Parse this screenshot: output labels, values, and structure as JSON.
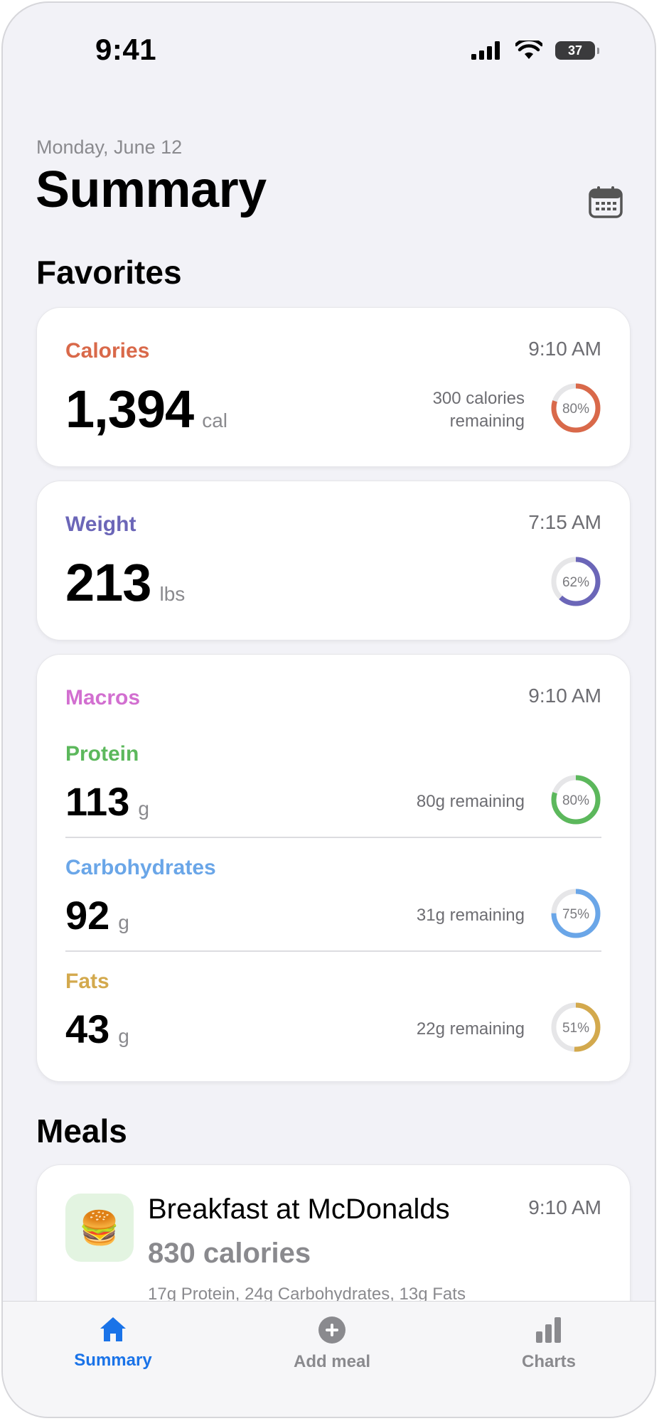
{
  "status_bar": {
    "time": "9:41",
    "battery": "37"
  },
  "header": {
    "date": "Monday, June 12",
    "title": "Summary"
  },
  "favorites": {
    "title": "Favorites",
    "calories": {
      "label": "Calories",
      "time": "9:10 AM",
      "value": "1,394",
      "unit": "cal",
      "remaining_line1": "300 calories",
      "remaining_line2": "remaining",
      "percent_label": "80%",
      "percent": 0.8,
      "color": "#d9694a"
    },
    "weight": {
      "label": "Weight",
      "time": "7:15 AM",
      "value": "213",
      "unit": "lbs",
      "percent_label": "62%",
      "percent": 0.62,
      "color": "#6b66b8"
    },
    "macros": {
      "label": "Macros",
      "time": "9:10 AM",
      "protein": {
        "label": "Protein",
        "value": "113",
        "unit": "g",
        "remaining": "80g remaining",
        "percent_label": "80%",
        "percent": 0.8,
        "color": "#5cb85c"
      },
      "carbs": {
        "label": "Carbohydrates",
        "value": "92",
        "unit": "g",
        "remaining": "31g remaining",
        "percent_label": "75%",
        "percent": 0.75,
        "color": "#6aa6e8"
      },
      "fats": {
        "label": "Fats",
        "value": "43",
        "unit": "g",
        "remaining": "22g remaining",
        "percent_label": "51%",
        "percent": 0.51,
        "color": "#d3a94d"
      }
    }
  },
  "meals": {
    "title": "Meals",
    "items": [
      {
        "emoji": "🍔",
        "name": "Breakfast at McDonalds",
        "calories": "830 calories",
        "macros": "17g Protein, 24g Carbohydrates, 13g Fats",
        "time": "9:10 AM"
      }
    ]
  },
  "tabbar": {
    "summary": {
      "label": "Summary",
      "icon": "home-icon"
    },
    "add_meal": {
      "label": "Add meal",
      "icon": "plus-circle-icon"
    },
    "charts": {
      "label": "Charts",
      "icon": "bar-chart-icon"
    },
    "active_color": "#1a73e8",
    "inactive_color": "#8a8a8e"
  },
  "colors": {
    "macros_label": "#d26fd0"
  }
}
